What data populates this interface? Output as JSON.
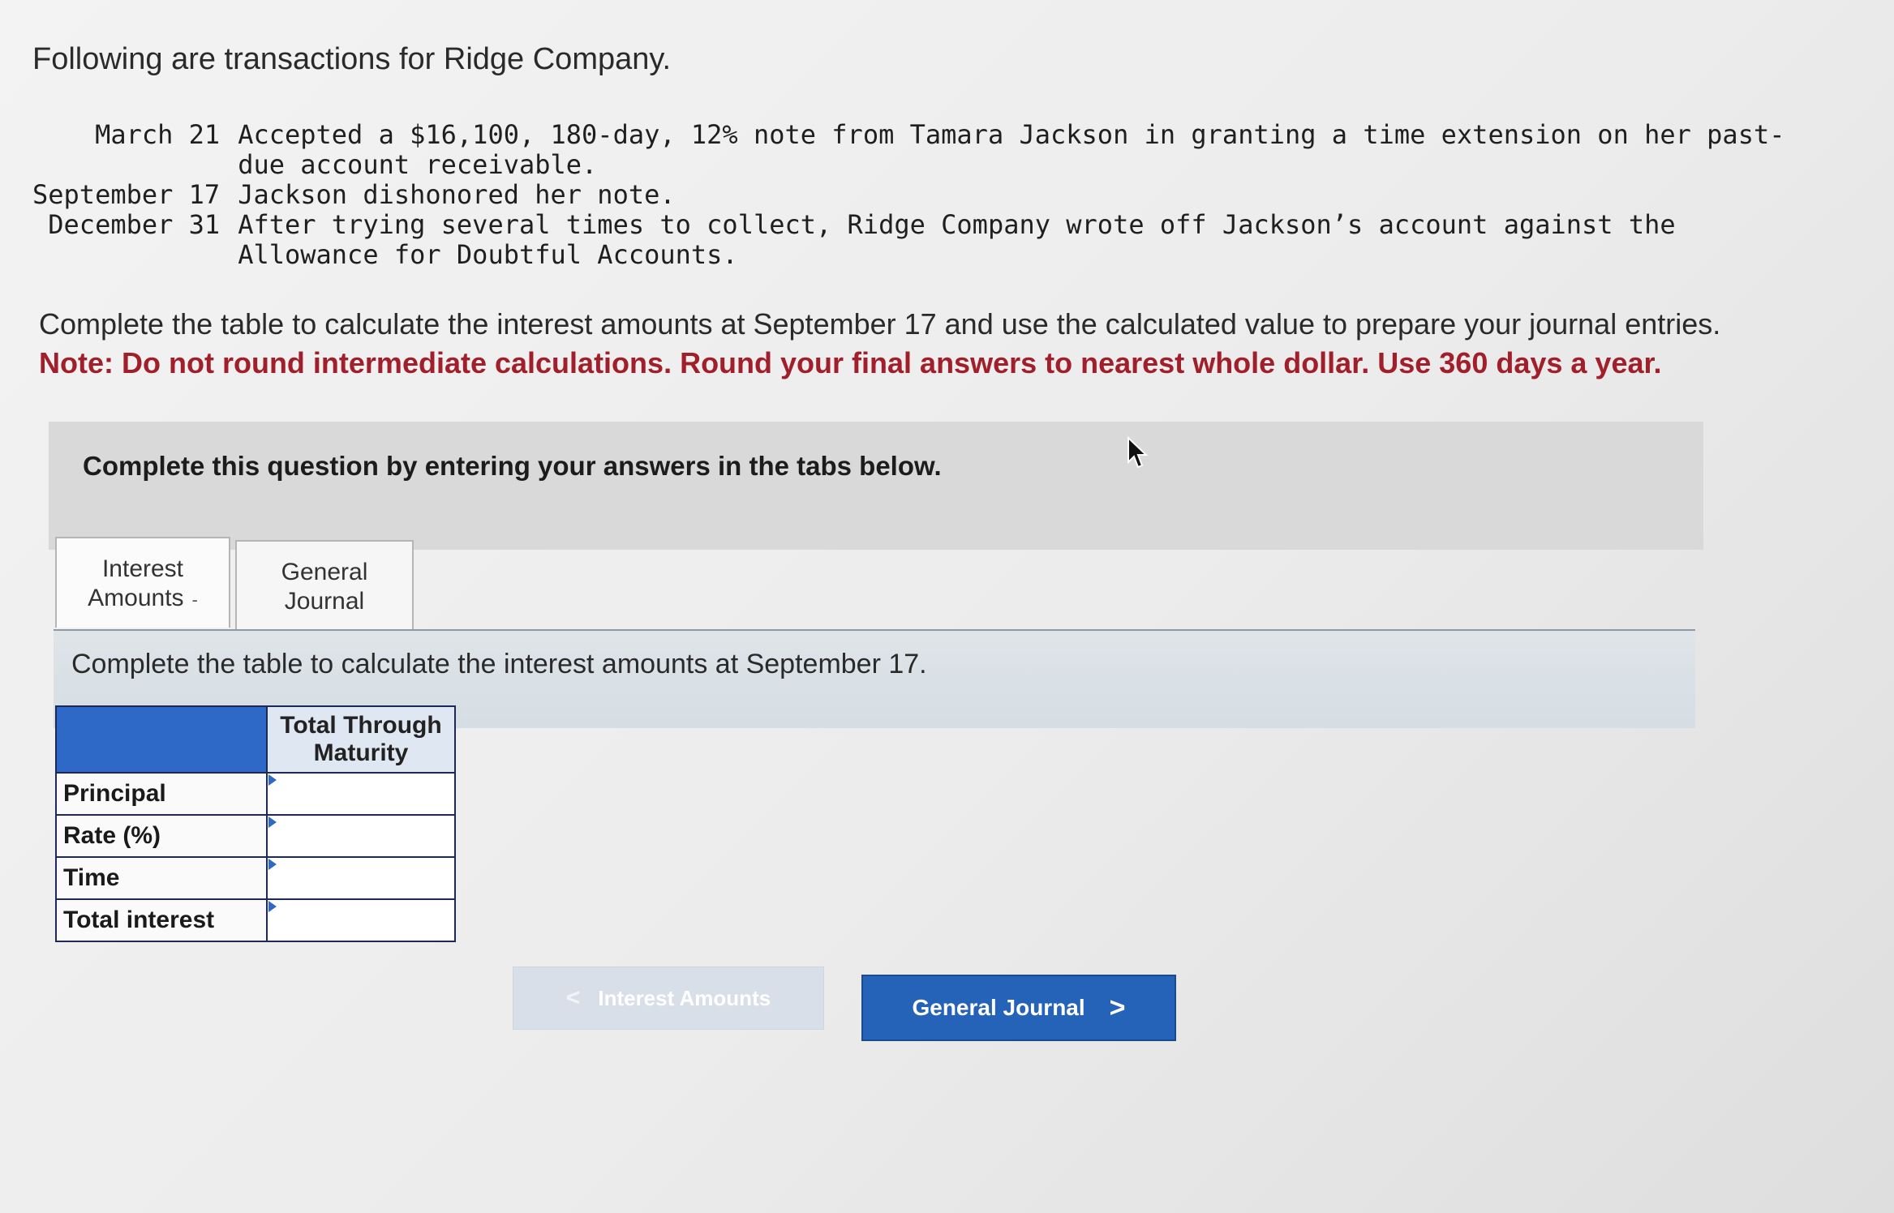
{
  "intro": "Following are transactions for Ridge Company.",
  "transactions": [
    {
      "date": "March 21",
      "text": "Accepted a $16,100, 180-day, 12% note from Tamara Jackson in granting a time extension on her past-due account receivable."
    },
    {
      "date": "September 17",
      "text": "Jackson dishonored her note."
    },
    {
      "date": "December 31",
      "text": "After trying several times to collect, Ridge Company wrote off Jackson’s account against the Allowance for Doubtful Accounts."
    }
  ],
  "instructions": {
    "main": "Complete the table to calculate the interest amounts at September 17 and use the calculated value to prepare your journal entries.",
    "note": "Note: Do not round intermediate calculations. Round your final answers to nearest whole dollar. Use 360 days a year."
  },
  "question_panel": {
    "text": "Complete this question by entering your answers in the tabs below."
  },
  "tabs": [
    {
      "line1": "Interest",
      "line2": "Amounts",
      "active_mark": "-"
    },
    {
      "line1": "General",
      "line2": "Journal"
    }
  ],
  "tab_content": {
    "instruction": "Complete the table to calculate the interest amounts at September 17."
  },
  "interest_table": {
    "column_header_line1": "Total Through",
    "column_header_line2": "Maturity",
    "rows": [
      {
        "label": "Principal",
        "value": ""
      },
      {
        "label": "Rate (%)",
        "value": ""
      },
      {
        "label": "Time",
        "value": ""
      },
      {
        "label": "Total interest",
        "value": ""
      }
    ]
  },
  "nav": {
    "prev_label": "Interest Amounts",
    "prev_chevron": "<",
    "next_label": "General Journal",
    "next_chevron": ">"
  },
  "colors": {
    "note_red": "#a11f2a",
    "table_header_blue": "#2f69c7",
    "next_button_blue": "#2563b8"
  }
}
